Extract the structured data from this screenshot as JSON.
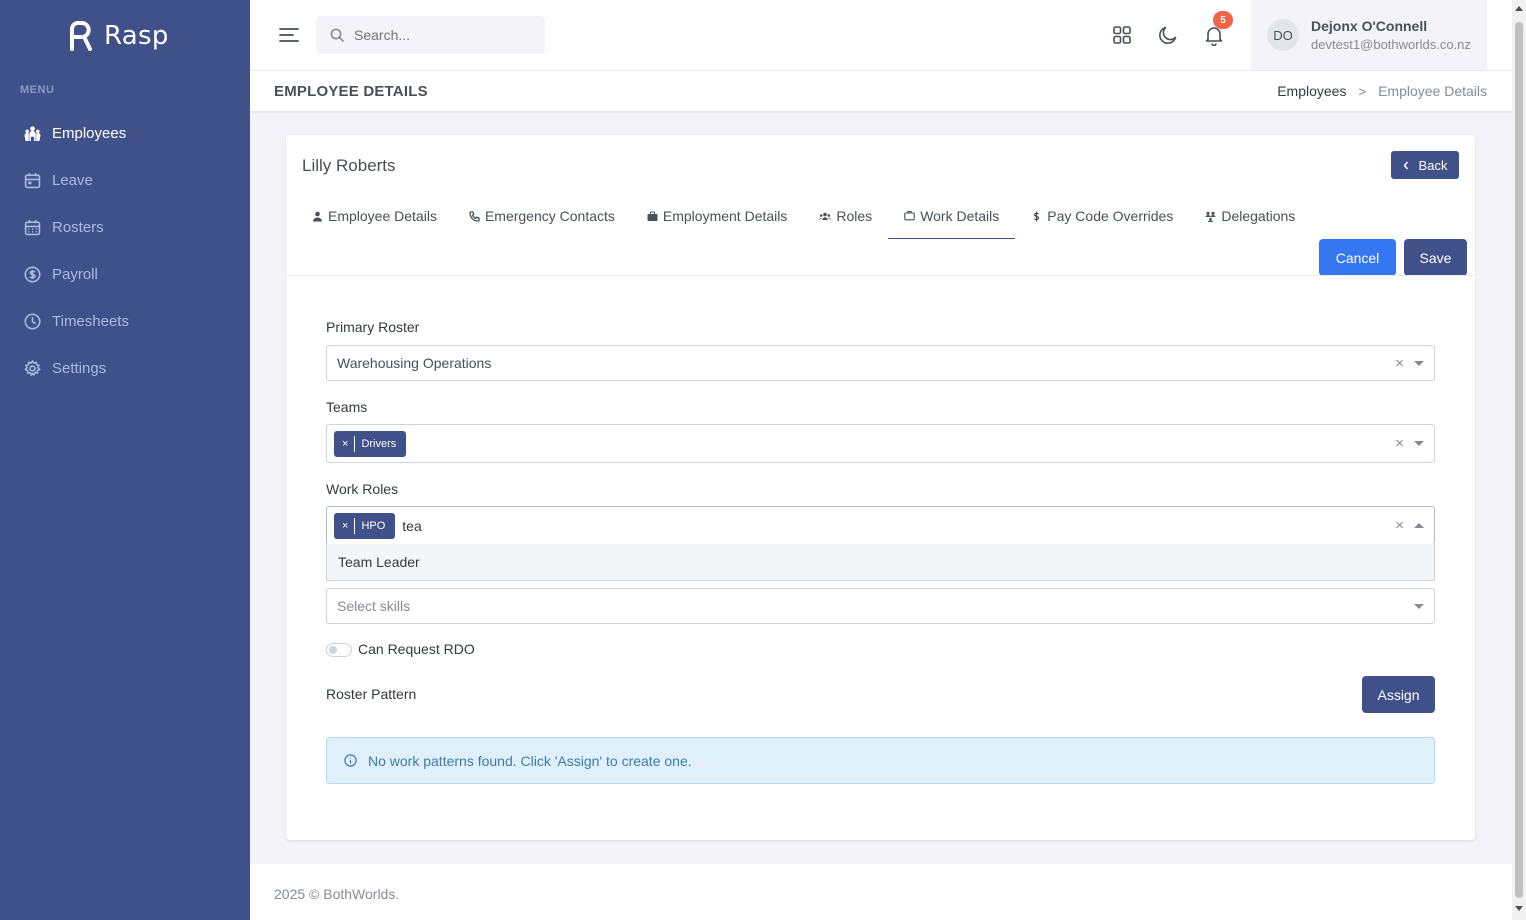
{
  "app": {
    "name": "Rasp"
  },
  "sidebar": {
    "menu_title": "MENU",
    "items": [
      {
        "label": "Employees",
        "icon": "people-icon",
        "active": true
      },
      {
        "label": "Leave",
        "icon": "calendar-icon",
        "active": false
      },
      {
        "label": "Rosters",
        "icon": "calendar-grid-icon",
        "active": false
      },
      {
        "label": "Payroll",
        "icon": "dollar-circle-icon",
        "active": false
      },
      {
        "label": "Timesheets",
        "icon": "clock-icon",
        "active": false
      },
      {
        "label": "Settings",
        "icon": "gear-icon",
        "active": false
      }
    ]
  },
  "topbar": {
    "search_placeholder": "Search...",
    "notification_count": "5",
    "user": {
      "initials": "DO",
      "name": "Dejonx O'Connell",
      "email": "devtest1@bothworlds.co.nz"
    }
  },
  "page": {
    "title": "EMPLOYEE DETAILS",
    "breadcrumb": {
      "parent": "Employees",
      "separator": ">",
      "current": "Employee Details"
    }
  },
  "card": {
    "employee_name": "Lilly Roberts",
    "back_label": "Back",
    "tabs": [
      {
        "label": "Employee Details",
        "icon": "user-icon"
      },
      {
        "label": "Emergency Contacts",
        "icon": "phone-icon"
      },
      {
        "label": "Employment Details",
        "icon": "briefcase-icon"
      },
      {
        "label": "Roles",
        "icon": "group-icon"
      },
      {
        "label": "Work Details",
        "icon": "briefcase-outline-icon",
        "active": true
      },
      {
        "label": "Pay Code Overrides",
        "icon": "dollar-icon"
      },
      {
        "label": "Delegations",
        "icon": "delegation-icon"
      }
    ],
    "cancel_label": "Cancel",
    "save_label": "Save"
  },
  "form": {
    "primary_roster": {
      "label": "Primary Roster",
      "value": "Warehousing Operations"
    },
    "teams": {
      "label": "Teams",
      "chips": [
        "Drivers"
      ]
    },
    "work_roles": {
      "label": "Work Roles",
      "chips": [
        "HPO"
      ],
      "typed": "tea",
      "option": "Team Leader"
    },
    "skills": {
      "placeholder": "Select skills"
    },
    "rdo": {
      "label": "Can Request RDO",
      "checked": false
    },
    "roster_pattern": {
      "label": "Roster Pattern",
      "assign_label": "Assign"
    },
    "alert": "No work patterns found. Click 'Assign' to create one."
  },
  "footer": {
    "text": "2025 © BothWorlds."
  },
  "colors": {
    "primary": "#405189",
    "cancel": "#3577f1",
    "badge": "#f06548",
    "info_bg": "#dff0fa"
  }
}
